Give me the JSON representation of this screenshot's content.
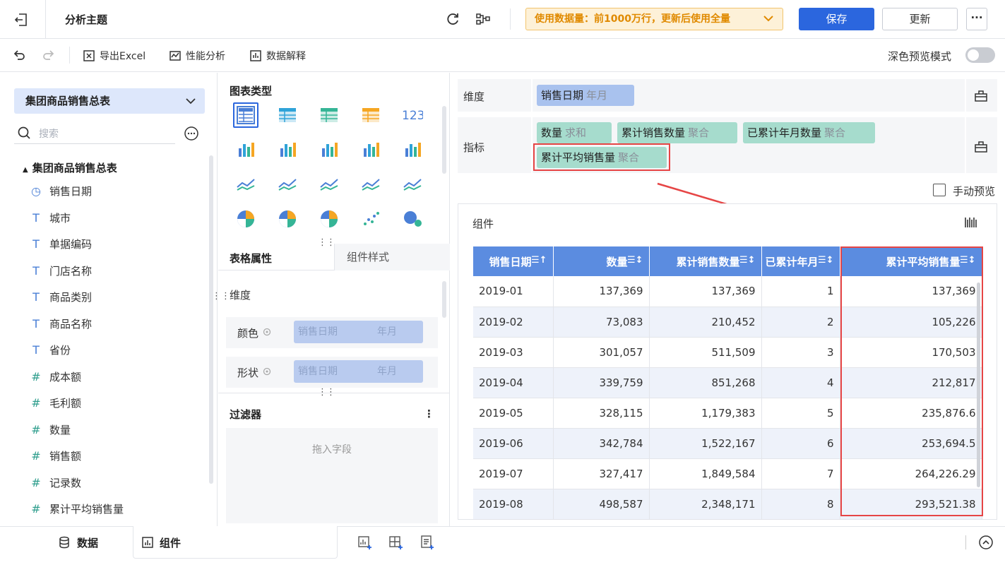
{
  "header": {
    "title": "分析主题",
    "notice": "使用数据量：前1000万行，更新后使用全量",
    "save_label": "保存",
    "update_label": "更新",
    "more_label": "···"
  },
  "toolbar": {
    "export_label": "导出Excel",
    "perf_label": "性能分析",
    "explain_label": "数据解释",
    "dark_label": "深色预览模式"
  },
  "left": {
    "dataset": "集团商品销售总表",
    "search_placeholder": "搜索",
    "tree_root": "集团商品销售总表",
    "fields": [
      {
        "icon": "◷",
        "label": "销售日期",
        "icon_name": "clock-icon"
      },
      {
        "icon": "T",
        "label": "城市",
        "icon_name": "text-type-icon"
      },
      {
        "icon": "T",
        "label": "单据编码",
        "icon_name": "text-type-icon"
      },
      {
        "icon": "T",
        "label": "门店名称",
        "icon_name": "text-type-icon"
      },
      {
        "icon": "T",
        "label": "商品类别",
        "icon_name": "text-type-icon"
      },
      {
        "icon": "T",
        "label": "商品名称",
        "icon_name": "text-type-icon"
      },
      {
        "icon": "T",
        "label": "省份",
        "icon_name": "text-type-icon"
      },
      {
        "icon": "#",
        "label": "成本额",
        "icon_name": "number-type-icon"
      },
      {
        "icon": "#",
        "label": "毛利额",
        "icon_name": "number-type-icon"
      },
      {
        "icon": "#",
        "label": "数量",
        "icon_name": "number-type-icon"
      },
      {
        "icon": "#",
        "label": "销售额",
        "icon_name": "number-type-icon"
      },
      {
        "icon": "#",
        "label": "记录数",
        "icon_name": "number-type-icon"
      },
      {
        "icon": "#",
        "label": "累计平均销售量",
        "icon_name": "calc-number-icon"
      }
    ]
  },
  "middle": {
    "chart_type_title": "图表类型",
    "tab_table_props": "表格属性",
    "tab_component_style": "组件样式",
    "dimension_label": "维度",
    "color_label": "颜色",
    "shape_label": "形状",
    "slot_field": "销售日期",
    "slot_sub": "年月",
    "filter_title": "过滤器",
    "filter_drop": "拖入字段"
  },
  "right": {
    "dim_label": "维度",
    "metric_label": "指标",
    "dim_chip": {
      "name": "销售日期",
      "sub": "年月"
    },
    "metric_chips": [
      {
        "name": "数量",
        "sub": "求和"
      },
      {
        "name": "累计销售数量",
        "sub": "聚合"
      },
      {
        "name": "已累计年月数量",
        "sub": "聚合"
      },
      {
        "name": "累计平均销售量",
        "sub": "聚合"
      }
    ],
    "manual_preview": "手动预览",
    "component_title": "组件",
    "table": {
      "headers": [
        "销售日期",
        "数量",
        "累计销售数量",
        "已累计年月",
        "累计平均销售量"
      ],
      "rows": [
        [
          "2019-01",
          "137,369",
          "137,369",
          "1",
          "137,369"
        ],
        [
          "2019-02",
          "73,083",
          "210,452",
          "2",
          "105,226"
        ],
        [
          "2019-03",
          "301,057",
          "511,509",
          "3",
          "170,503"
        ],
        [
          "2019-04",
          "339,759",
          "851,268",
          "4",
          "212,817"
        ],
        [
          "2019-05",
          "328,115",
          "1,179,383",
          "5",
          "235,876.6"
        ],
        [
          "2019-06",
          "342,784",
          "1,522,167",
          "6",
          "253,694.5"
        ],
        [
          "2019-07",
          "327,417",
          "1,849,584",
          "7",
          "264,226.29"
        ],
        [
          "2019-08",
          "498,587",
          "2,348,171",
          "8",
          "293,521.38"
        ]
      ]
    }
  },
  "bottom": {
    "data_tab": "数据",
    "component_tab": "组件"
  },
  "colors": {
    "accent": "#2b66de",
    "header_bg": "#5b8ce0",
    "highlight": "#e64545",
    "dim_chip": "#a9c2ee",
    "metric_chip": "#a6dccd"
  }
}
